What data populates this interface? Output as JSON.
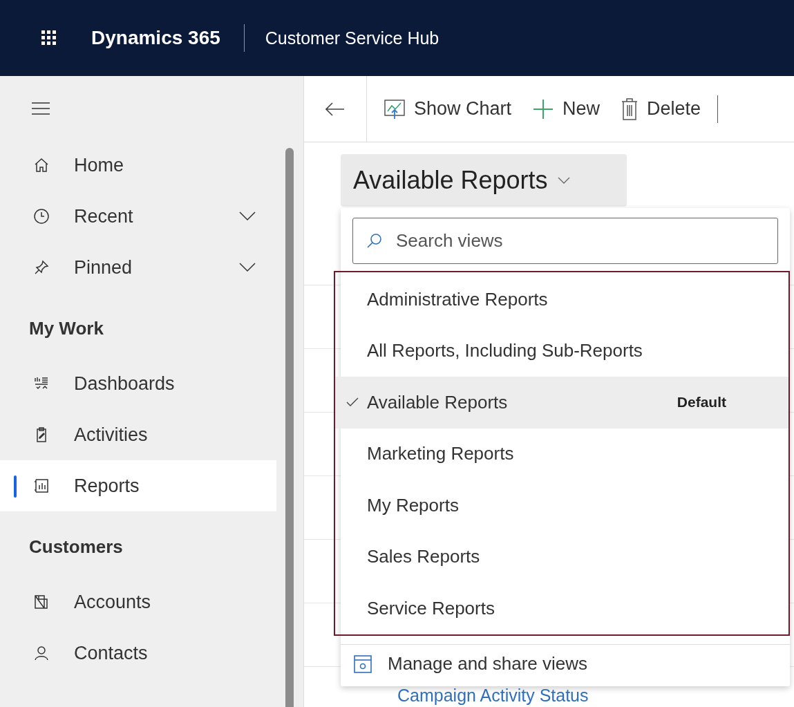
{
  "header": {
    "app_name": "Dynamics 365",
    "area_name": "Customer Service Hub"
  },
  "sidebar": {
    "items": [
      {
        "kind": "nav",
        "label": "Home",
        "selected": false
      },
      {
        "kind": "nav",
        "label": "Recent",
        "selected": false,
        "expanded": false
      },
      {
        "kind": "nav",
        "label": "Pinned",
        "selected": false,
        "expanded": false
      },
      {
        "kind": "heading",
        "label": "My Work"
      },
      {
        "kind": "nav",
        "label": "Dashboards",
        "selected": false
      },
      {
        "kind": "nav",
        "label": "Activities",
        "selected": false
      },
      {
        "kind": "nav",
        "label": "Reports",
        "selected": true
      },
      {
        "kind": "heading",
        "label": "Customers"
      },
      {
        "kind": "nav",
        "label": "Accounts",
        "selected": false
      },
      {
        "kind": "nav",
        "label": "Contacts",
        "selected": false
      }
    ]
  },
  "toolbar": {
    "buttons": [
      {
        "label": "Show Chart"
      },
      {
        "label": "New"
      },
      {
        "label": "Delete"
      }
    ]
  },
  "view_selector": {
    "label": "Available Reports",
    "expanded": true
  },
  "view_menu": {
    "search": {
      "placeholder": "Search views"
    },
    "views": [
      {
        "label": "Administrative Reports",
        "selected": false
      },
      {
        "label": "All Reports, Including Sub-Reports",
        "selected": false
      },
      {
        "label": "Available Reports",
        "selected": true,
        "badge": "Default"
      },
      {
        "label": "Marketing Reports",
        "selected": false
      },
      {
        "label": "My Reports",
        "selected": false
      },
      {
        "label": "Sales Reports",
        "selected": false
      },
      {
        "label": "Service Reports",
        "selected": false
      }
    ],
    "footer": "Manage and share views"
  },
  "grid": {
    "rows": [
      {
        "title": ""
      }
    ],
    "visible_link": "Campaign Activity Status"
  }
}
